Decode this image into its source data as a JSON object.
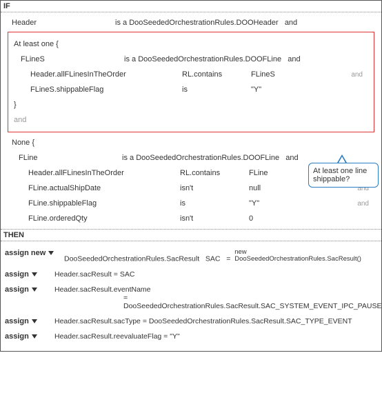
{
  "section": {
    "if_label": "IF",
    "then_label": "THEN"
  },
  "if_block": {
    "header": {
      "var": "Header",
      "isa": "is a",
      "type": "DooSeededOrchestrationRules.DOOHeader",
      "and": "and"
    },
    "at_least_one": {
      "open": "At least one  {",
      "fline": {
        "var": "FLineS",
        "isa": "is a",
        "type": "DooSeededOrchestrationRules.DOOFLine",
        "and": "and"
      },
      "c1": {
        "lhs": "Header.allFLinesInTheOrder",
        "op": "RL.contains",
        "rhs": "FLineS",
        "and": "and"
      },
      "c2": {
        "lhs": "FLineS.shippableFlag",
        "op": "is",
        "rhs": "\"Y\"",
        "and": ""
      },
      "close": "}",
      "trailing_and": "and"
    },
    "none": {
      "open": "None  {",
      "fline": {
        "var": "FLine",
        "isa": "is a",
        "type": "DooSeededOrchestrationRules.DOOFLine",
        "and": "and"
      },
      "c1": {
        "lhs": "Header.allFLinesInTheOrder",
        "op": "RL.contains",
        "rhs": "FLine",
        "and": "and"
      },
      "c2": {
        "lhs": "FLine.actualShipDate",
        "op": "isn't",
        "rhs": "null",
        "and": "and"
      },
      "c3": {
        "lhs": "FLine.shippableFlag",
        "op": "is",
        "rhs": "\"Y\"",
        "and": "and"
      },
      "c4": {
        "lhs": "FLine.orderedQty",
        "op": "isn't",
        "rhs": "0",
        "and": ""
      }
    }
  },
  "callout": {
    "text": "At least one line shippable?"
  },
  "then_block": {
    "assign_new_label": "assign new",
    "assign_label": "assign",
    "a1": {
      "type": "DooSeededOrchestrationRules.SacResult",
      "var": "SAC",
      "eq": "=",
      "new_kw": "new",
      "ctor": "DooSeededOrchestrationRules.SacResult()"
    },
    "a2": {
      "expr": "Header.sacResult  =  SAC"
    },
    "a3": {
      "lhs": "Header.sacResult.eventName",
      "rhs": "=  DooSeededOrchestrationRules.SacResult.SAC_SYSTEM_EVENT_IPC_PAUSE"
    },
    "a4": {
      "expr": "Header.sacResult.sacType  =  DooSeededOrchestrationRules.SacResult.SAC_TYPE_EVENT"
    },
    "a5": {
      "expr": "Header.sacResult.reevaluateFlag  =  \"Y\""
    }
  }
}
